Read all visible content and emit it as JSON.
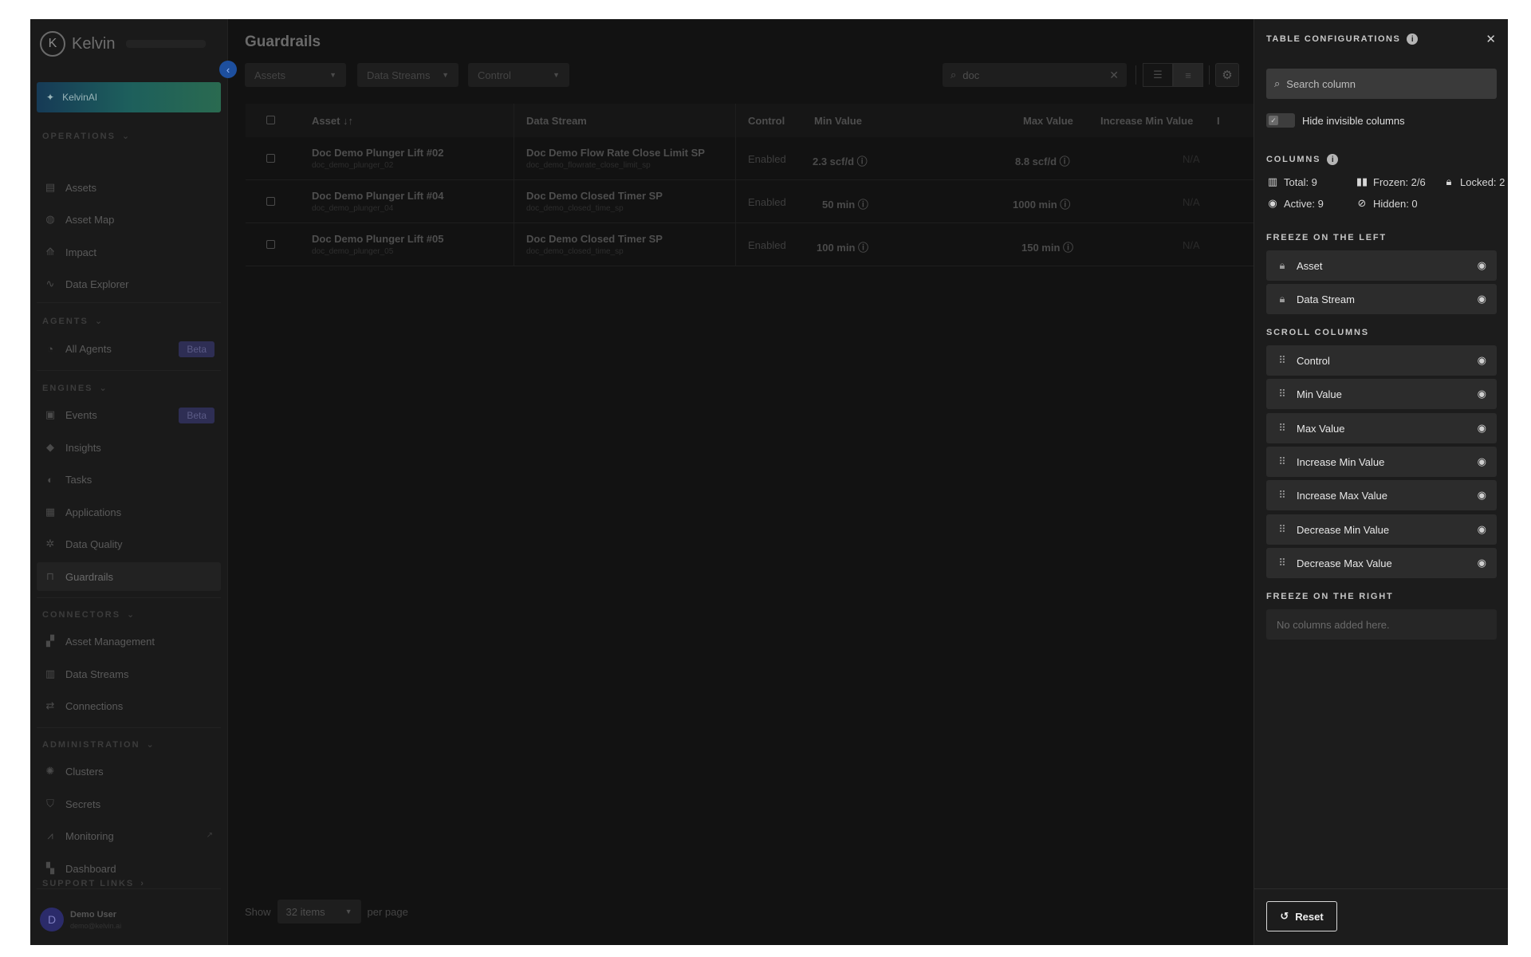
{
  "sidebar": {
    "brand": "Kelvin",
    "kelvinai_label": "KelvinAI",
    "sections": {
      "operations": "OPERATIONS",
      "agents": "AGENTS",
      "engines": "ENGINES",
      "connectors": "CONNECTORS",
      "administration": "ADMINISTRATION",
      "support": "SUPPORT LINKS"
    },
    "items": {
      "assets": "Assets",
      "asset_map": "Asset Map",
      "impact": "Impact",
      "data_explorer": "Data Explorer",
      "all_agents": "All Agents",
      "events": "Events",
      "insights": "Insights",
      "tasks": "Tasks",
      "applications": "Applications",
      "data_quality": "Data Quality",
      "guardrails": "Guardrails",
      "asset_management": "Asset Management",
      "data_streams": "Data Streams",
      "connections": "Connections",
      "clusters": "Clusters",
      "secrets": "Secrets",
      "monitoring": "Monitoring",
      "dashboard": "Dashboard"
    },
    "beta_label": "Beta",
    "user": {
      "initial": "D",
      "name": "Demo User",
      "email": "demo@kelvin.ai"
    }
  },
  "main": {
    "title": "Guardrails",
    "filters": {
      "assets": "Assets",
      "data_streams": "Data Streams",
      "control": "Control"
    },
    "search": {
      "value": "doc"
    },
    "table": {
      "headers": {
        "asset": "Asset",
        "data_stream": "Data Stream",
        "control": "Control",
        "min_value": "Min Value",
        "max_value": "Max Value",
        "increase_min_value": "Increase Min Value",
        "next": "I"
      },
      "rows": [
        {
          "asset": "Doc Demo Plunger Lift #02",
          "asset_id": "doc_demo_plunger_02",
          "stream": "Doc Demo Flow Rate Close Limit SP",
          "stream_id": "doc_demo_flowrate_close_limit_sp",
          "control": "Enabled",
          "min": "2.3 scf/d",
          "max": "8.8 scf/d",
          "inc_min": "N/A"
        },
        {
          "asset": "Doc Demo Plunger Lift #04",
          "asset_id": "doc_demo_plunger_04",
          "stream": "Doc Demo Closed Timer SP",
          "stream_id": "doc_demo_closed_time_sp",
          "control": "Enabled",
          "min": "50 min",
          "max": "1000 min",
          "inc_min": "N/A"
        },
        {
          "asset": "Doc Demo Plunger Lift #05",
          "asset_id": "doc_demo_plunger_05",
          "stream": "Doc Demo Closed Timer SP",
          "stream_id": "doc_demo_closed_time_sp",
          "control": "Enabled",
          "min": "100 min",
          "max": "150 min",
          "inc_min": "N/A"
        }
      ]
    },
    "pager": {
      "show": "Show",
      "items": "32 items",
      "per_page": "per page"
    }
  },
  "panel": {
    "title": "TABLE CONFIGURATIONS",
    "search_placeholder": "Search column",
    "hide_invisible": "Hide invisible columns",
    "columns_label": "COLUMNS",
    "stats": {
      "total": "Total: 9",
      "frozen": "Frozen: 2/6",
      "locked": "Locked: 2",
      "active": "Active: 9",
      "hidden": "Hidden: 0"
    },
    "freeze_left_label": "FREEZE ON THE LEFT",
    "freeze_left": [
      "Asset",
      "Data Stream"
    ],
    "scroll_label": "SCROLL COLUMNS",
    "scroll": [
      "Control",
      "Min Value",
      "Max Value",
      "Increase Min Value",
      "Increase Max Value",
      "Decrease Min Value",
      "Decrease Max Value"
    ],
    "freeze_right_label": "FREEZE ON THE RIGHT",
    "freeze_right_empty": "No columns added here.",
    "reset_label": "Reset"
  }
}
